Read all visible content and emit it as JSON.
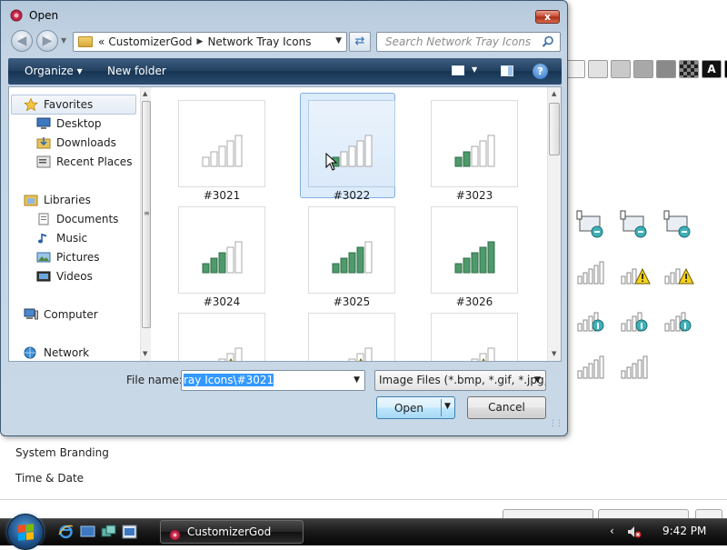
{
  "dialog": {
    "title": "Open",
    "close_label": "x",
    "address": {
      "overflow": "«",
      "crumbs": [
        "CustomizerGod",
        "Network Tray Icons"
      ]
    },
    "search_placeholder": "Search Network Tray Icons",
    "toolbar": {
      "organize_label": "Organize ▾",
      "new_folder_label": "New folder",
      "help_label": "?"
    },
    "nav": {
      "favorites": "Favorites",
      "desktop": "Desktop",
      "downloads": "Downloads",
      "recent_places": "Recent Places",
      "libraries": "Libraries",
      "documents": "Documents",
      "music": "Music",
      "pictures": "Pictures",
      "videos": "Videos",
      "computer": "Computer",
      "network": "Network"
    },
    "files": [
      {
        "name": "#3021",
        "bars_filled": 0,
        "warning": false
      },
      {
        "name": "#3022",
        "bars_filled": 1,
        "warning": false,
        "selected": true
      },
      {
        "name": "#3023",
        "bars_filled": 2,
        "warning": false
      },
      {
        "name": "#3024",
        "bars_filled": 3,
        "warning": false
      },
      {
        "name": "#3025",
        "bars_filled": 4,
        "warning": false
      },
      {
        "name": "#3026",
        "bars_filled": 5,
        "warning": false
      },
      {
        "name": "",
        "bars_filled": 0,
        "warning": true
      },
      {
        "name": "",
        "bars_filled": 1,
        "warning": true
      },
      {
        "name": "",
        "bars_filled": 2,
        "warning": true
      }
    ],
    "file_name_label": "File name:",
    "file_name_value": "ray Icons\\#3021",
    "file_type_value": "Image Files (*.bmp, *.gif, *.jpg,",
    "open_label": "Open",
    "cancel_label": "Cancel"
  },
  "background": {
    "swatch_text": "A",
    "list_items": [
      "System Branding",
      "Time & Date"
    ],
    "colors": [
      "#f4f4f4",
      "#e2e2e2",
      "#c9c9c9",
      "#a8a8a8",
      "#8a8a8a",
      "#3a3a3a",
      "#111111",
      "#000000"
    ]
  },
  "taskbar": {
    "app_label": "CustomizerGod",
    "tray_arrow": "‹",
    "clock": "9:42 PM"
  },
  "colors": {
    "bar_fill": "#4e9a6a",
    "bar_empty": "#a9a9a9",
    "warning": "#f5d21c",
    "selection": "#3399ff"
  }
}
